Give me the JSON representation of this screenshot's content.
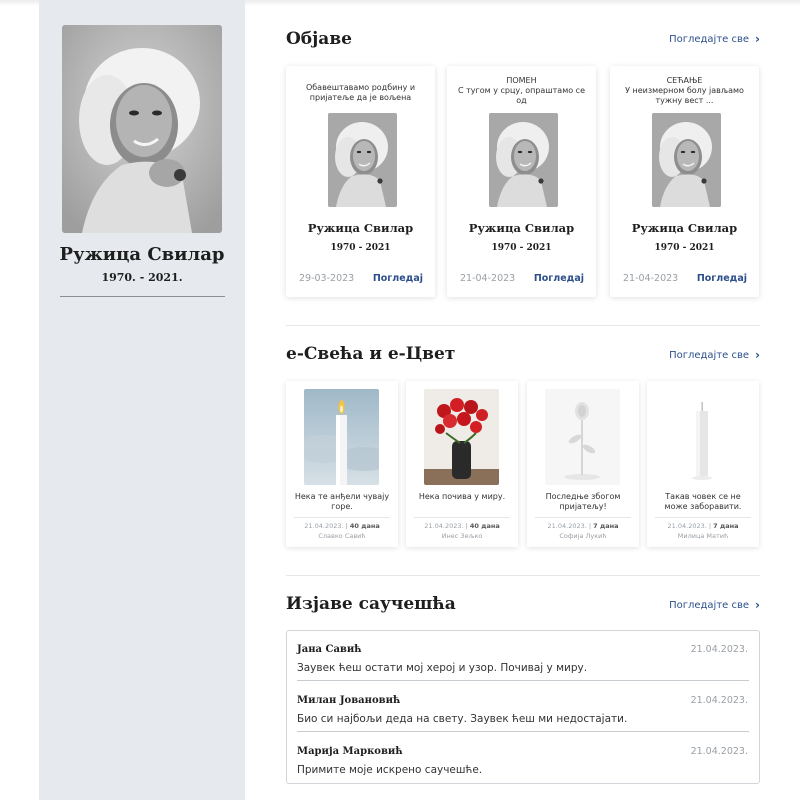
{
  "profile": {
    "name": "Ружица Свилар",
    "years": "1970. - 2021."
  },
  "sections": {
    "posts_title": "Објаве",
    "gifts_title": "е-Свећа и е-Цвет",
    "condolences_title": "Изјаве саучешћа",
    "see_all": "Погледајте све"
  },
  "obituaries": [
    {
      "type": "",
      "text": "Обавештавамо родбину и пријатеље да је вољена",
      "name": "Ружица Свилар",
      "years": "1970 - 2021",
      "date": "29-03-2023",
      "action": "Погледај"
    },
    {
      "type": "ПОМЕН",
      "text": "С тугом у срцу, опраштамо се од",
      "name": "Ружица Свилар",
      "years": "1970 - 2021",
      "date": "21-04-2023",
      "action": "Погледај"
    },
    {
      "type": "СЕЋАЊЕ",
      "text": "У неизмерном болу јављамо тужну вест ...",
      "name": "Ружица Свилар",
      "years": "1970 - 2021",
      "date": "21-04-2023",
      "action": "Погледај"
    }
  ],
  "gifts": [
    {
      "kind": "candle-lit",
      "text": "Нека те анђели чувају горе.",
      "date": "21.04.2023.",
      "duration": "40 дана",
      "author": "Славко Савић"
    },
    {
      "kind": "roses",
      "text": "Нека почива у миру.",
      "date": "21.04.2023.",
      "duration": "40 дана",
      "author": "Инес Зељко"
    },
    {
      "kind": "white-rose",
      "text": "Последње збогом пријатељу!",
      "date": "21.04.2023.",
      "duration": "7 дана",
      "author": "Софија Лукић"
    },
    {
      "kind": "white-candle",
      "text": "Такав човек се не може заборавити.",
      "date": "21.04.2023.",
      "duration": "7 дана",
      "author": "Милица Матић"
    }
  ],
  "condolences": [
    {
      "name": "Јана Савић",
      "date": "21.04.2023.",
      "text": "Заувек ћеш остати мој херој и узор. Почивај у миру."
    },
    {
      "name": "Милан Јовановић",
      "date": "21.04.2023.",
      "text": "Био си најбољи деда на свету. Заувек ћеш ми недостајати."
    },
    {
      "name": "Марија Марковић",
      "date": "21.04.2023.",
      "text": "Примите моје искрено саучешће."
    }
  ],
  "colors": {
    "sidebar_bg": "#e6eaee",
    "link": "#2c4f8c",
    "muted": "#9aa0a6"
  }
}
